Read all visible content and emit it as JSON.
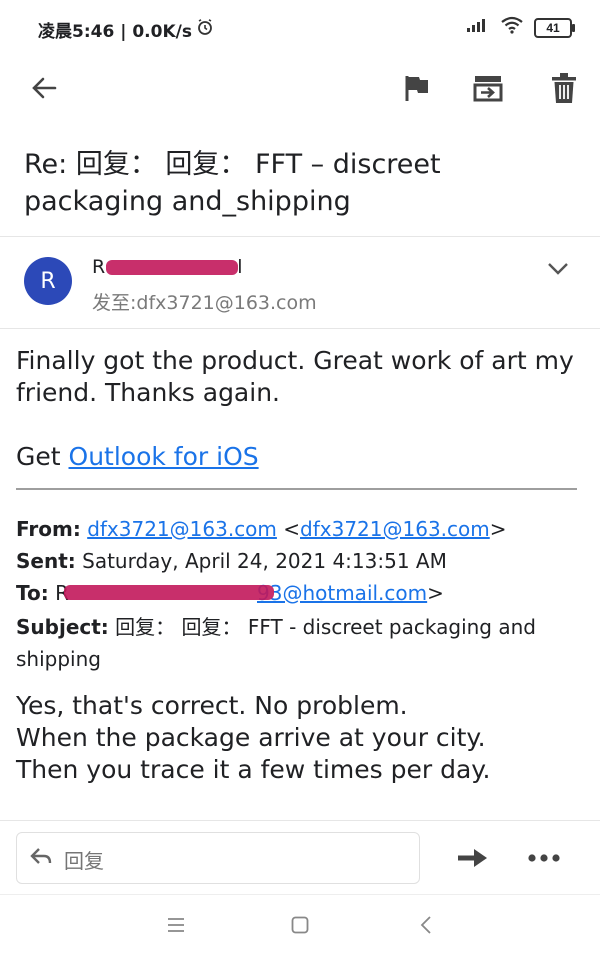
{
  "status_bar": {
    "time_text": "凌晨5:46 | 0.0K/s",
    "battery": "41"
  },
  "email": {
    "subject": "Re: 回复： 回复： FFT – discreet packaging and_shipping",
    "avatar_letter": "R",
    "sender_visible_start": "R",
    "sender_visible_end": "l",
    "recipient_line": "发至:dfx3721@163.com",
    "body_line1": "Finally got the product. Great work of art my",
    "body_line2": "friend. Thanks again.",
    "get_prefix": "Get ",
    "outlook_link": "Outlook for iOS",
    "quoted": {
      "from_label": "From:",
      "from_email": "dfx3721@163.com",
      "from_email_bracket": "dfx3721@163.com",
      "sent_label": "Sent:",
      "sent_value": "Saturday, April 24, 2021 4:13:51 AM",
      "to_label": "To:",
      "to_visible_start": "R",
      "to_email_tail": "93@hotmail.com",
      "subject_label": "Subject:",
      "subject_value": "回复： 回复： FFT - discreet packaging and shipping",
      "line1": "Yes, that's correct. No problem.",
      "line2": "When the package arrive at your city.",
      "line3": "Then you trace it a few times per day."
    }
  },
  "reply_bar": {
    "reply_label": "回复"
  },
  "colors": {
    "avatar_bg": "#2c49b8",
    "link": "#1a73e8",
    "redaction": "#c2185b"
  }
}
